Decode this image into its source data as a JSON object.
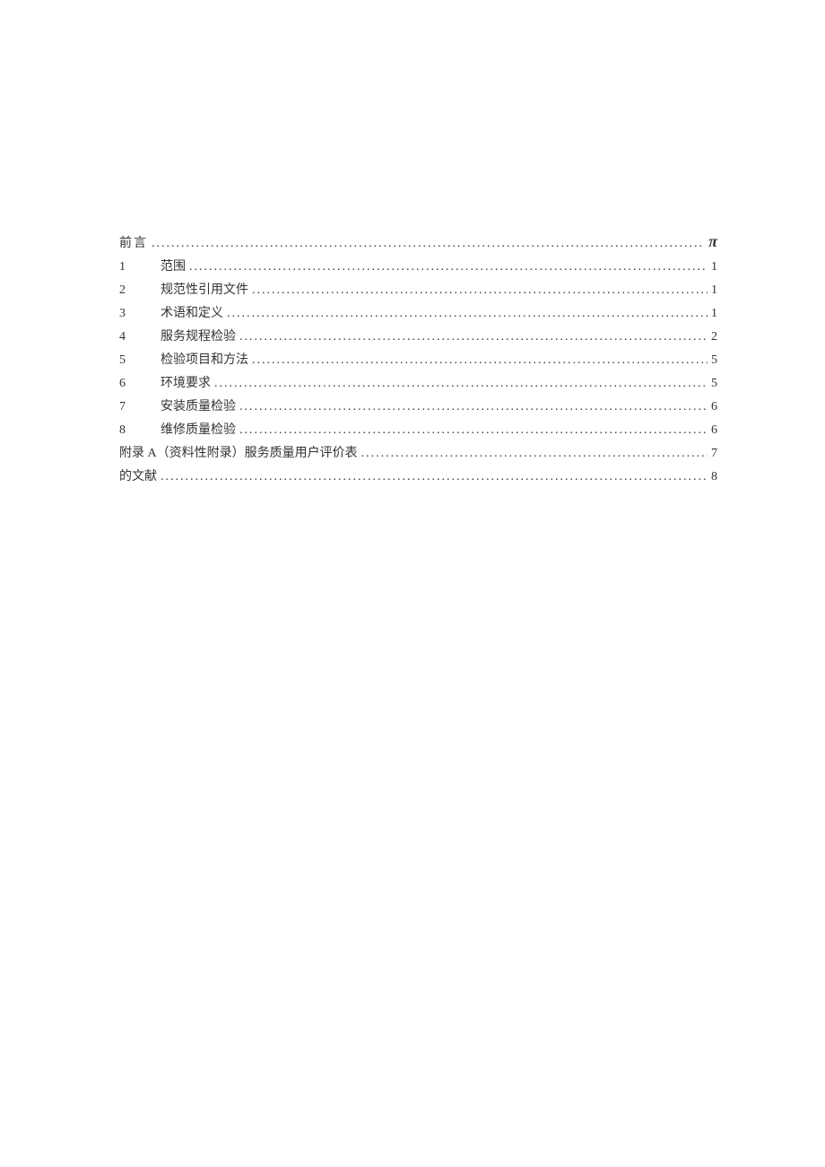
{
  "toc": {
    "preface": {
      "title": "前言",
      "page": "π"
    },
    "items": [
      {
        "num": "1",
        "title": "范围",
        "page": "1"
      },
      {
        "num": "2",
        "title": "规范性引用文件",
        "page": "1"
      },
      {
        "num": "3",
        "title": "术语和定义",
        "page": "1"
      },
      {
        "num": "4",
        "title": "服务规程检验",
        "page": "2"
      },
      {
        "num": "5",
        "title": "检验项目和方法",
        "page": "5"
      },
      {
        "num": "6",
        "title": "环境要求",
        "page": "5"
      },
      {
        "num": "7",
        "title": "安装质量检验",
        "page": "6"
      },
      {
        "num": "8",
        "title": "维修质量检验",
        "page": "6"
      }
    ],
    "appendix": {
      "title": "附录 A（资料性附录）服务质量用户评价表",
      "page": "7"
    },
    "refs": {
      "title": "的文献",
      "page": "8"
    }
  }
}
